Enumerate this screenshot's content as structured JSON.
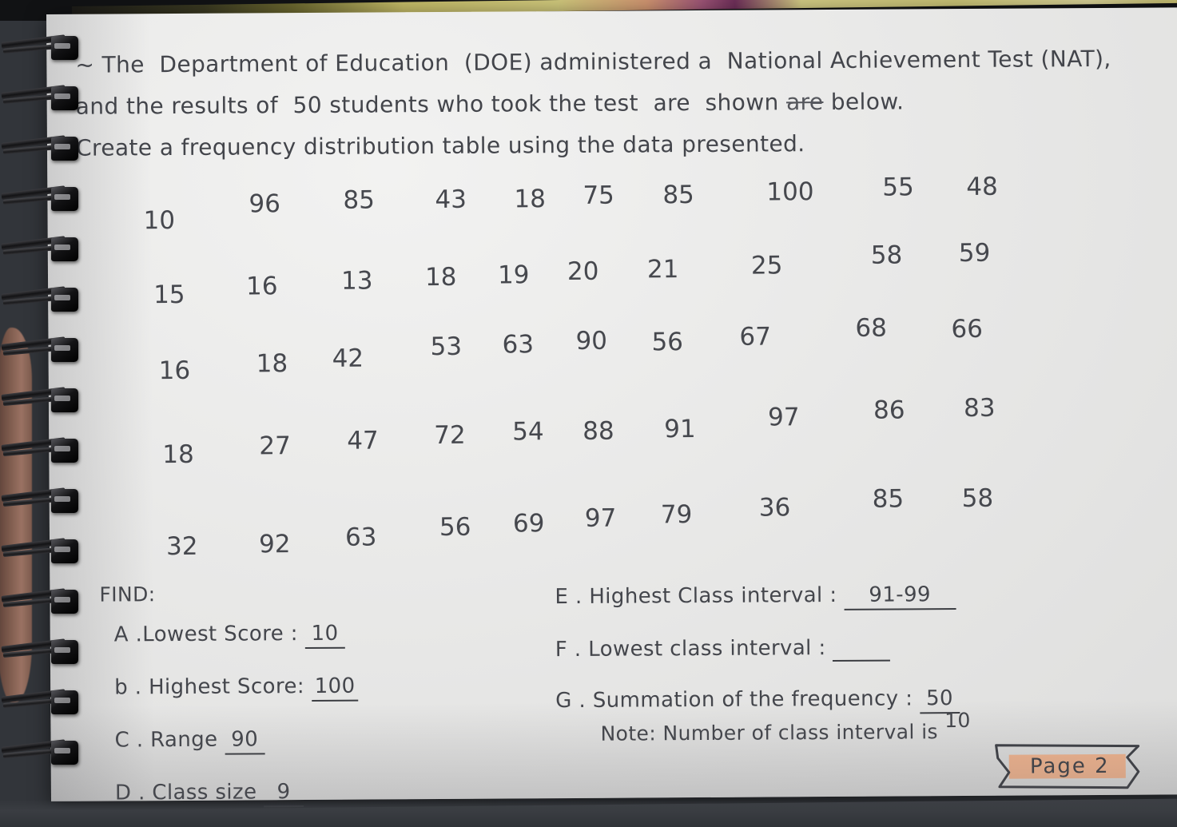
{
  "document": {
    "kind": "handwritten-notebook-page",
    "page_label": "Page 2",
    "banner_highlight_color": "#f5b48c",
    "ink_color": "#44464c",
    "paper_color": "#ebebea"
  },
  "prompt": {
    "line1": "~ The  Department of Education  (DOE) administered a  National Achievement Test (NAT),",
    "line2_a": "and the results of  50 students who took the test  are  shown ",
    "line2_struck": "are",
    "line2_b": " below.",
    "line3": "Create a frequency distribution table using the data presented."
  },
  "chart_data": {
    "type": "table",
    "title": "National Achievement Test scores of 50 students",
    "rows": [
      [
        "10",
        "96",
        "85",
        "43",
        "18",
        "75",
        "85",
        "100",
        "55",
        "48"
      ],
      [
        "15",
        "16",
        "13",
        "18",
        "19",
        "20",
        "21",
        "25",
        "58",
        "59"
      ],
      [
        "16",
        "18",
        "42",
        "53",
        "63",
        "90",
        "56",
        "67",
        "68",
        "66"
      ],
      [
        "18",
        "27",
        "47",
        "72",
        "54",
        "88",
        "91",
        "97",
        "86",
        "83"
      ],
      [
        "32",
        "92",
        "63",
        "56",
        "69",
        "97",
        "79",
        "36",
        "85",
        "58"
      ]
    ],
    "count": 50,
    "min": 10,
    "max": 100,
    "range": 90
  },
  "find": {
    "heading": "FIND:",
    "left_items": [
      {
        "key": "A .Lowest  Score :",
        "answer": "10"
      },
      {
        "key": "b . Highest  Score:",
        "answer": "100"
      },
      {
        "key": "C . Range",
        "answer": "90"
      },
      {
        "key": "D . Class size",
        "answer": "9"
      }
    ],
    "right_items": [
      {
        "key": "E . Highest Class interval :",
        "answer": "91-99"
      },
      {
        "key": "F . Lowest class interval :",
        "answer": ""
      },
      {
        "key": "G . Summation of the frequency :",
        "answer": "50"
      }
    ]
  },
  "note": {
    "text": "Note:  Number of class interval is",
    "answer": "10"
  }
}
